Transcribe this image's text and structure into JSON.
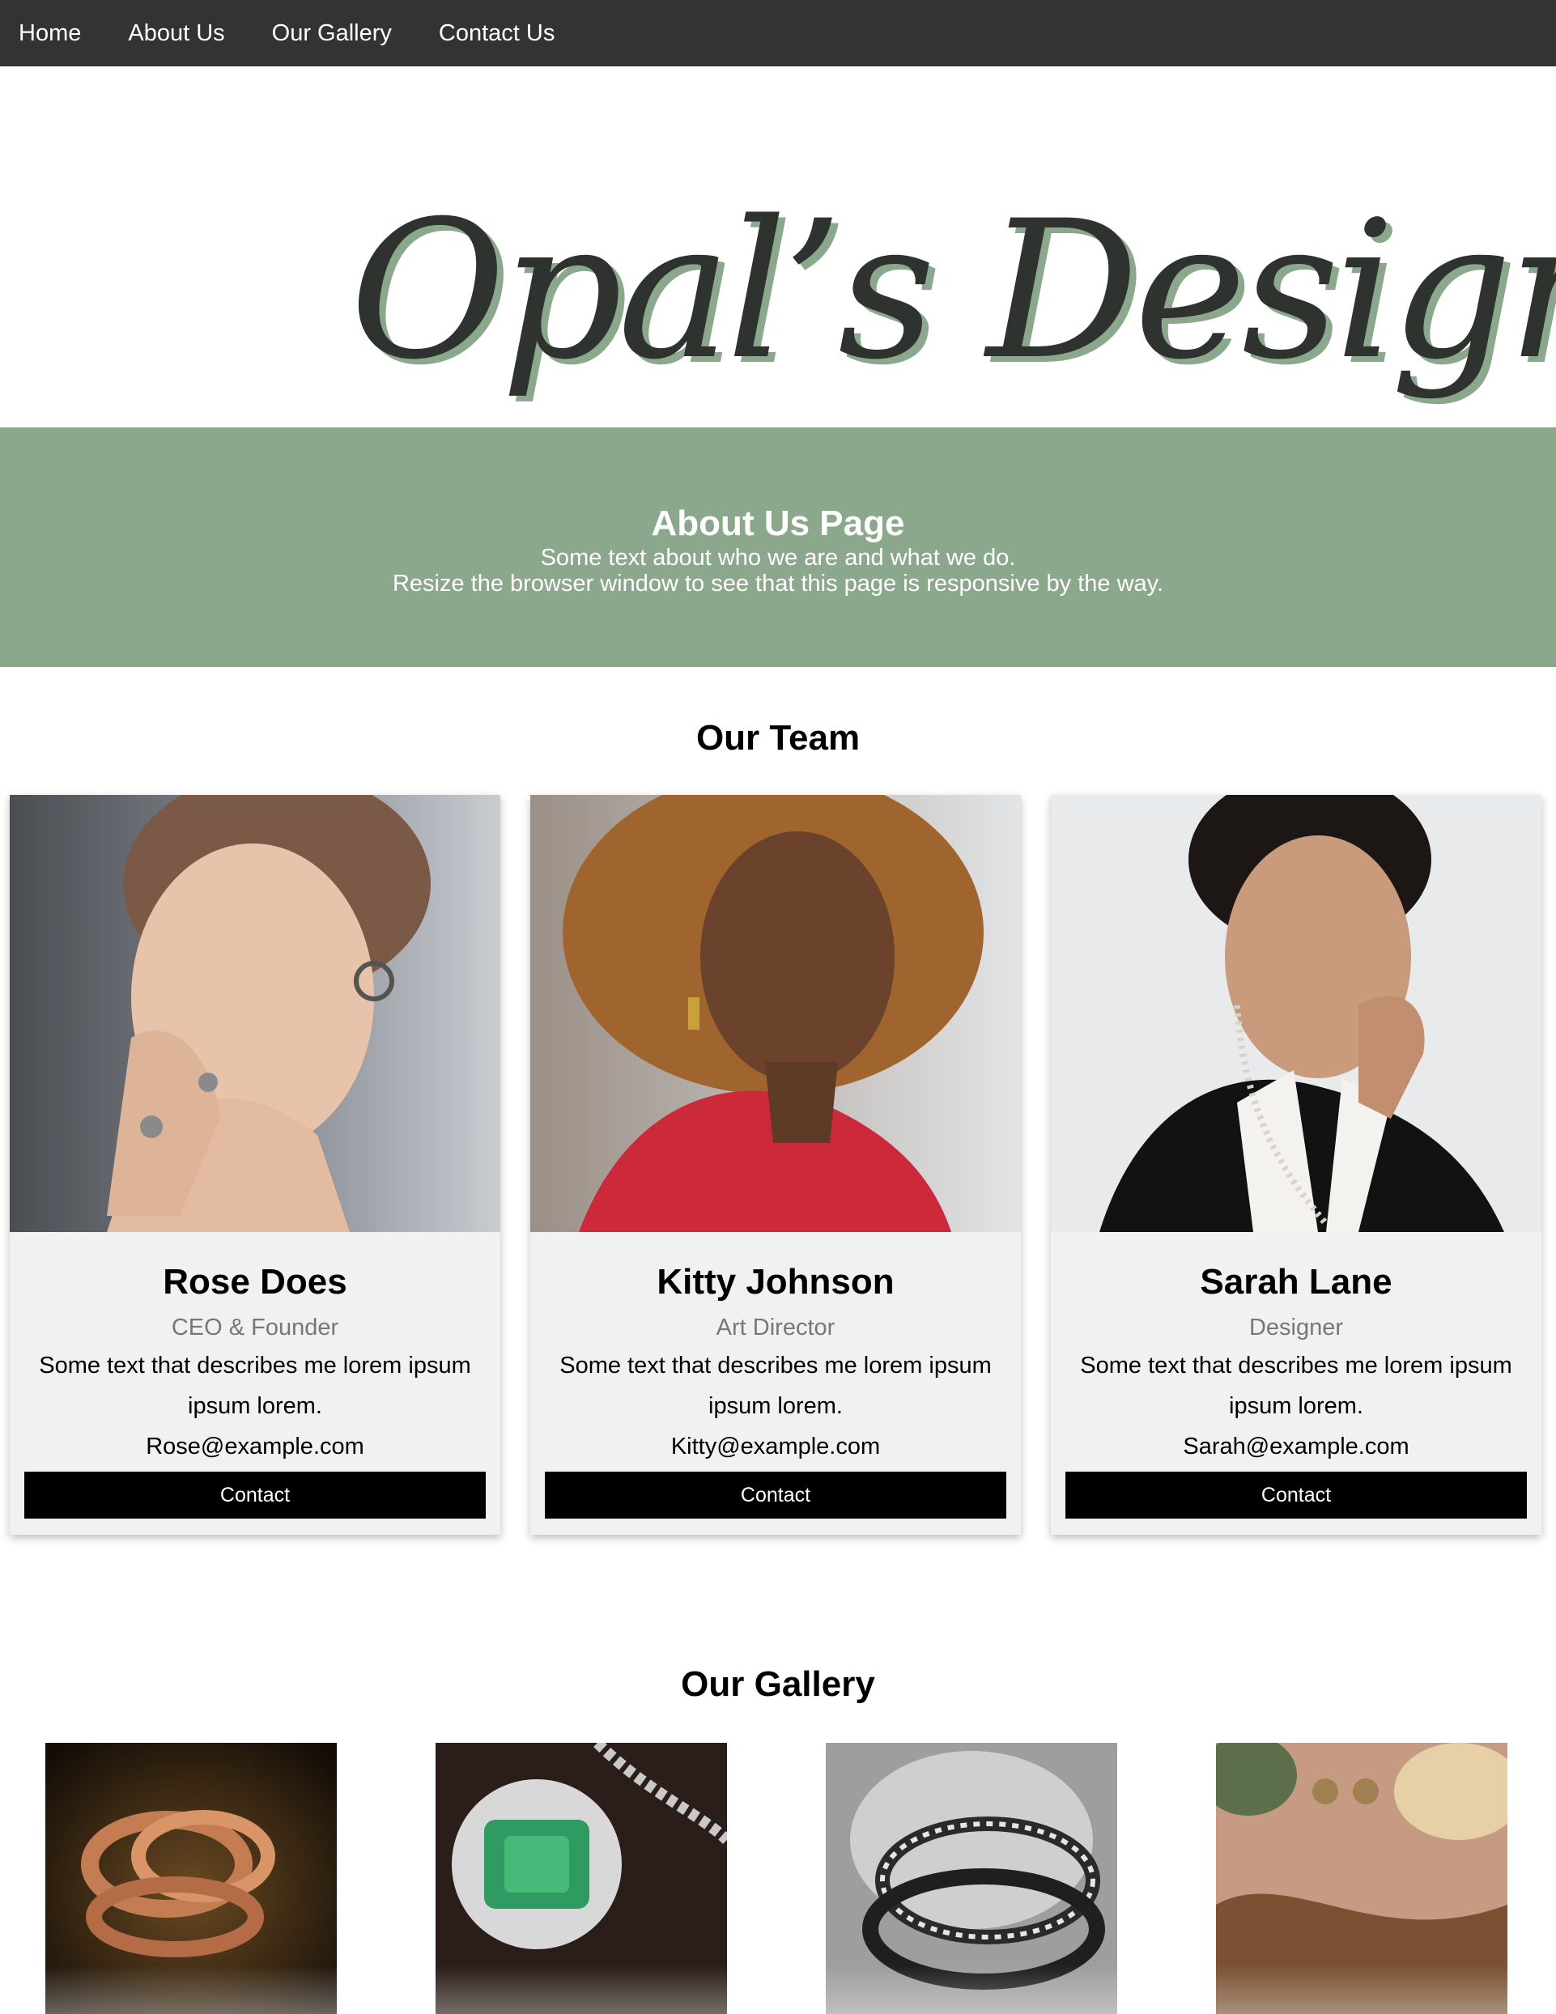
{
  "nav": {
    "items": [
      "Home",
      "About Us",
      "Our Gallery",
      "Contact Us"
    ]
  },
  "logo": {
    "text": "Opal’s Design"
  },
  "hero": {
    "title": "About Us Page",
    "line1": "Some text about who we are and what we do.",
    "line2": "Resize the browser window to see that this page is responsive by the way."
  },
  "team": {
    "title": "Our Team",
    "members": [
      {
        "name": "Rose Does",
        "role": "CEO & Founder",
        "desc": "Some text that describes me lorem ipsum ipsum lorem.",
        "email": "Rose@example.com",
        "button": "Contact"
      },
      {
        "name": "Kitty Johnson",
        "role": "Art Director",
        "desc": "Some text that describes me lorem ipsum ipsum lorem.",
        "email": "Kitty@example.com",
        "button": "Contact"
      },
      {
        "name": "Sarah Lane",
        "role": "Designer",
        "desc": "Some text that describes me lorem ipsum ipsum lorem.",
        "email": "Sarah@example.com",
        "button": "Contact"
      }
    ]
  },
  "gallery": {
    "title": "Our Gallery"
  },
  "colors": {
    "nav_bg": "#333333",
    "hero_bg": "#8ba88d",
    "card_bg": "#f1f1f1",
    "button_bg": "#000000",
    "role_text": "#777777",
    "logo_ink": "#2f332f",
    "logo_shadow": "#8ba88d"
  }
}
